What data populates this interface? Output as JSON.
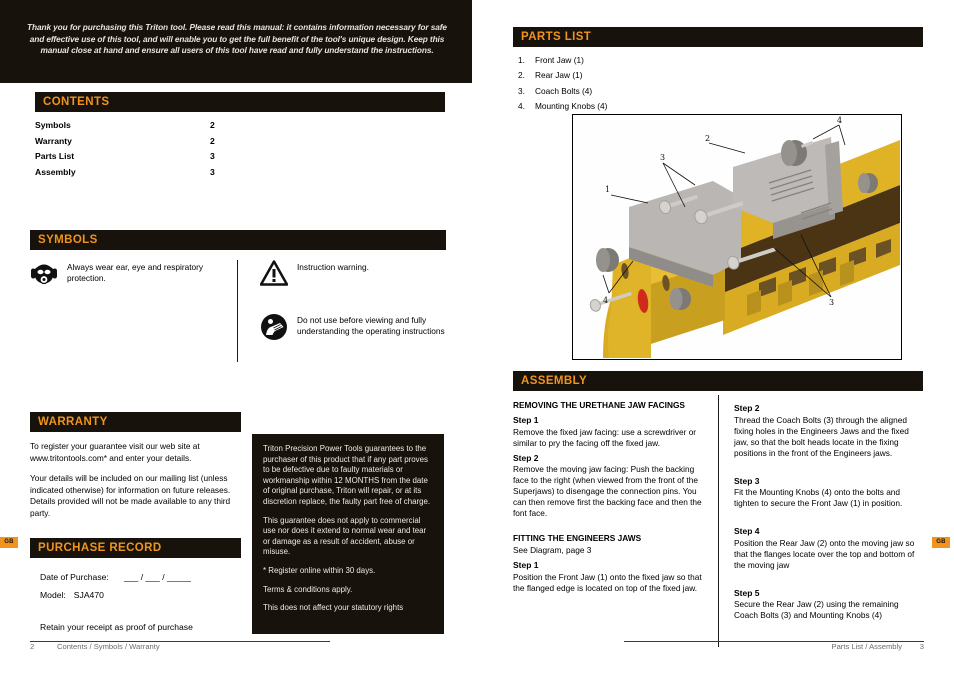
{
  "colors": {
    "dark": "#17120b",
    "accent_orange": "#f0941e",
    "body_text": "#000000",
    "footer_text": "#6d6d6d",
    "reverse_text": "#efece4"
  },
  "intro": {
    "text": "Thank you for purchasing this Triton tool. Please read this manual: it contains information necessary for safe and effective use of this tool, and will enable you to get the full benefit of the tool's unique design. Keep this manual close at hand and ensure all users of this tool have read and fully understand the instructions."
  },
  "left_page": {
    "contents": {
      "heading": "CONTENTS",
      "rows": [
        {
          "name": "Symbols",
          "page": "2"
        },
        {
          "name": "Warranty",
          "page": "2"
        },
        {
          "name": "Parts List",
          "page": "3"
        },
        {
          "name": "Assembly",
          "page": "3"
        }
      ]
    },
    "symbols": {
      "heading": "SYMBOLS",
      "items": [
        {
          "icon": "ppe-face-icon",
          "text": "Always wear ear, eye and respiratory protection."
        },
        {
          "icon": "warning-triangle-icon",
          "text": "Instruction warning."
        },
        {
          "icon": "read-instructions-icon",
          "text": "Do not use before viewing and fully understanding the operating instructions"
        }
      ]
    },
    "warranty": {
      "heading": "WARRANTY",
      "paragraphs": [
        "To register your guarantee visit our web site at www.tritontools.com* and enter your details.",
        "Your details will be included on our mailing list (unless indicated otherwise) for information on future releases. Details provided will not be made available to any third party."
      ],
      "box_paragraphs": [
        "Triton Precision Power Tools guarantees to the purchaser of this product that if any part proves to be defective due to faulty materials or workmanship within 12 MONTHS from the date of original purchase, Triton will repair, or at its discretion replace, the faulty part free of charge.",
        "This guarantee does not apply to commercial use nor does it extend to normal wear and tear or damage as a result of accident, abuse or misuse.",
        "* Register online within 30 days.",
        "Terms & conditions apply.",
        "This does not affect your statutory rights"
      ]
    },
    "purchase_record": {
      "heading": "PURCHASE RECORD",
      "date_label": "Date of Purchase:",
      "date_value": "___ / ___ / _____",
      "model_label": "Model:",
      "model_value": "SJA470",
      "note": "Retain your receipt as proof of purchase"
    },
    "footer": {
      "page_number": "2",
      "text": "Contents / Symbols / Warranty"
    },
    "language_tab": "GB"
  },
  "right_page": {
    "parts_list": {
      "heading": "PARTS LIST",
      "items": [
        {
          "num": "1.",
          "name": "Front Jaw (1)"
        },
        {
          "num": "2.",
          "name": "Rear Jaw (1)"
        },
        {
          "num": "3.",
          "name": "Coach Bolts (4)"
        },
        {
          "num": "4.",
          "name": "Mounting Knobs (4)"
        }
      ]
    },
    "diagram": {
      "name": "superjaws-exploded-assembly-diagram",
      "callouts": [
        "1",
        "2",
        "3",
        "3",
        "4",
        "4"
      ]
    },
    "assembly": {
      "heading": "ASSEMBLY",
      "left_column": [
        {
          "type": "subheading",
          "text": "REMOVING THE URETHANE JAW FACINGS"
        },
        {
          "type": "step",
          "text": "Step 1"
        },
        {
          "type": "body",
          "text": "Remove the fixed jaw facing: use a screwdriver or similar to pry the facing off the fixed jaw."
        },
        {
          "type": "step",
          "text": "Step 2"
        },
        {
          "type": "body",
          "text": "Remove the moving jaw facing: Push the backing face to the right (when viewed from the front of the Superjaws) to disengage the connection pins. You can then remove first the backing face and then the font face."
        },
        {
          "type": "gap",
          "text": ""
        },
        {
          "type": "subheading",
          "text": "FITTING THE ENGINEERS JAWS"
        },
        {
          "type": "body",
          "text": "See Diagram, page 3"
        },
        {
          "type": "step",
          "text": "Step 1"
        },
        {
          "type": "body",
          "text": "Position the Front Jaw (1) onto the fixed jaw so that the flanged edge is located on top of the fixed jaw."
        }
      ],
      "right_column": [
        {
          "type": "step",
          "text": "Step 2"
        },
        {
          "type": "body",
          "text": "Thread the Coach Bolts (3) through the aligned fixing holes in the Engineers Jaws and the fixed jaw, so that the bolt heads locate in the fixing positions in the front of the Engineers jaws."
        },
        {
          "type": "gap",
          "text": ""
        },
        {
          "type": "step",
          "text": "Step 3"
        },
        {
          "type": "body",
          "text": "Fit the Mounting Knobs (4) onto the bolts and tighten to secure the Front Jaw (1) in position."
        },
        {
          "type": "gap",
          "text": ""
        },
        {
          "type": "step",
          "text": "Step 4"
        },
        {
          "type": "body",
          "text": "Position the Rear Jaw (2) onto the moving jaw so that the flanges locate over the top and bottom of the moving jaw"
        },
        {
          "type": "gap",
          "text": ""
        },
        {
          "type": "step",
          "text": "Step 5"
        },
        {
          "type": "body",
          "text": "Secure the Rear Jaw (2) using the remaining Coach Bolts (3) and Mounting Knobs (4)"
        }
      ]
    },
    "footer": {
      "page_number": "3",
      "text": "Parts List / Assembly"
    },
    "language_tab": "GB"
  }
}
